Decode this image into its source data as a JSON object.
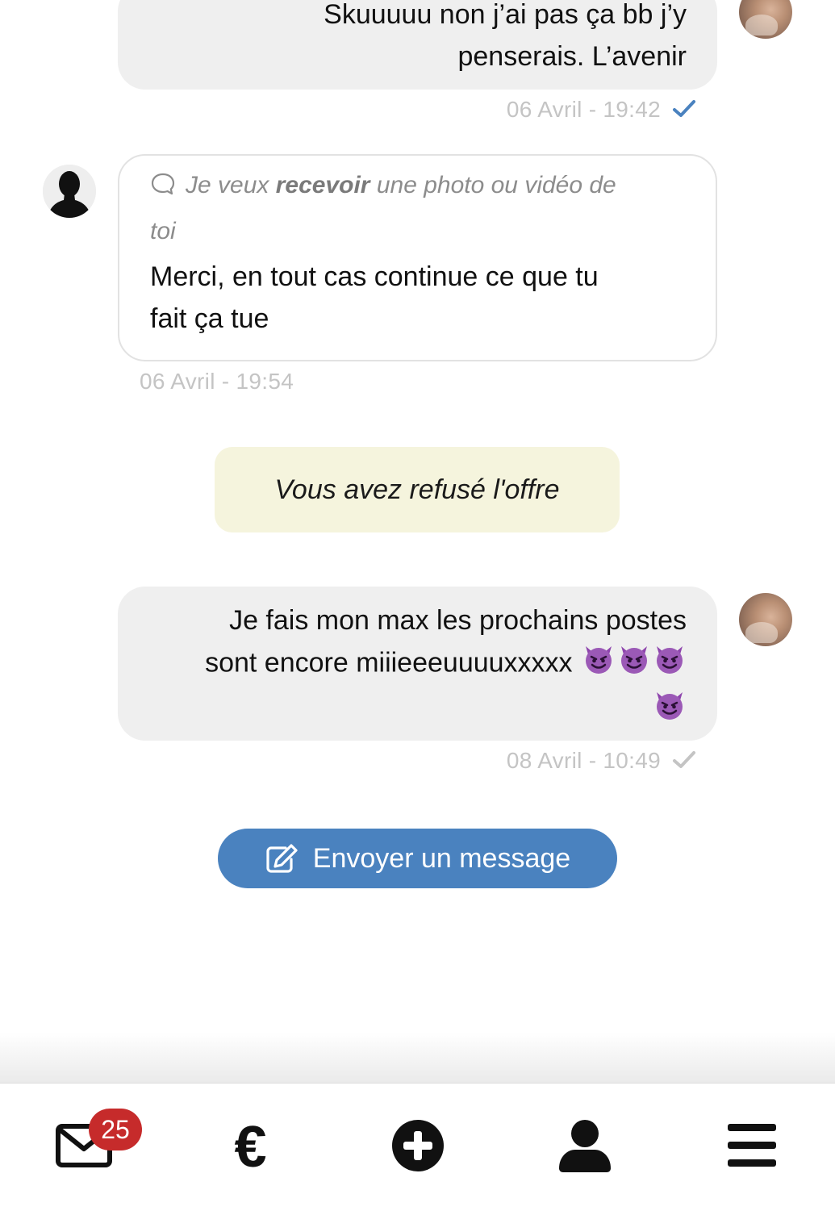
{
  "messages": [
    {
      "sender": "me",
      "text_line1": "Skuuuuu non j’ai pas ça bb j’y",
      "text_line2": "penserais. L’avenir",
      "timestamp": "06 Avril - 19:42",
      "read": true
    },
    {
      "sender": "them",
      "quote_prefix": "Je veux ",
      "quote_bold": "recevoir",
      "quote_suffix": " une photo ou vidéo de",
      "quote_line2": "toi",
      "text_line1": "Merci, en tout cas continue ce que tu",
      "text_line2": "fait ça tue",
      "timestamp": "06 Avril - 19:54"
    },
    {
      "sender": "system",
      "text": "Vous avez refusé l'offre"
    },
    {
      "sender": "me",
      "text_line1": "Je fais mon max les prochains postes",
      "text_line2": "sont encore miiieeeuuuuxxxxx",
      "emoji": "smiling-imp",
      "timestamp": "08 Avril - 10:49",
      "read": false
    }
  ],
  "send_button": {
    "label": "Envoyer un message",
    "icon": "edit-icon"
  },
  "bottom_nav": {
    "items": [
      {
        "icon": "mail-icon",
        "badge": "25"
      },
      {
        "icon": "euro-icon",
        "label": "€"
      },
      {
        "icon": "plus-circle-icon"
      },
      {
        "icon": "user-icon"
      },
      {
        "icon": "menu-icon"
      }
    ]
  },
  "colors": {
    "accent": "#4a82bf",
    "badge": "#c62b2b",
    "read_check": "#4a82bf",
    "unread_check": "#c4c4c4",
    "offer_bg": "#f5f4dd",
    "my_bubble": "#efefef"
  }
}
